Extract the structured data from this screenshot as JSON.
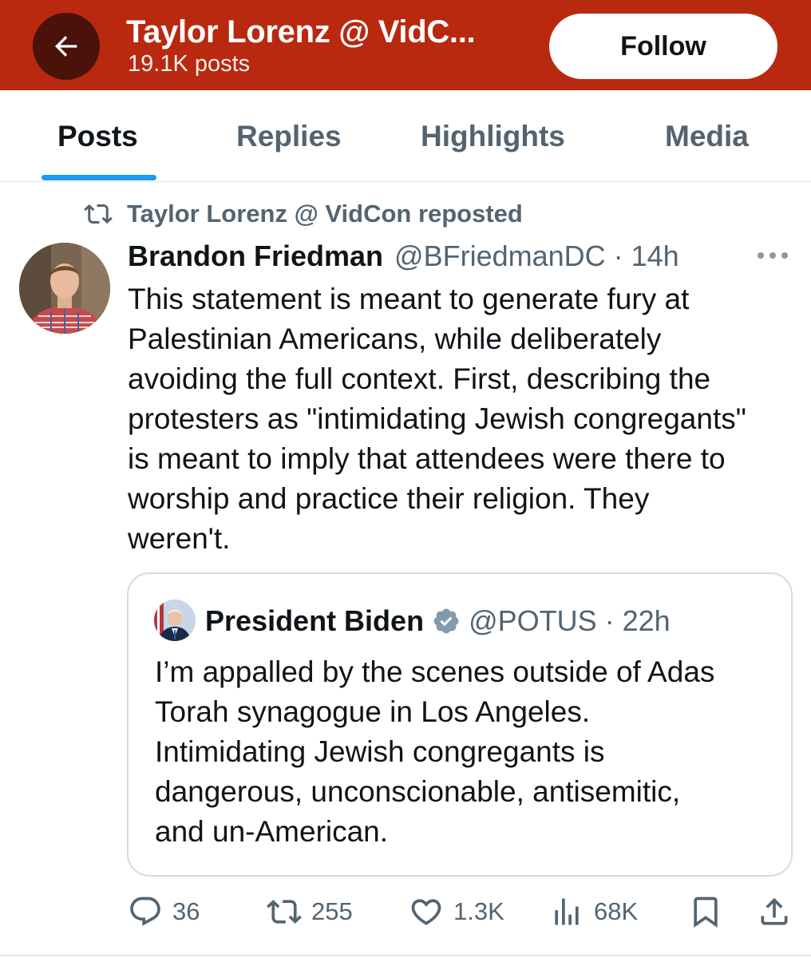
{
  "header": {
    "title": "Taylor Lorenz @ VidC...",
    "subtitle": "19.1K posts",
    "follow_label": "Follow",
    "back_icon": "arrow-left-icon",
    "background_color": "#b8290f"
  },
  "tabs": [
    {
      "label": "Posts",
      "active": true
    },
    {
      "label": "Replies",
      "active": false
    },
    {
      "label": "Highlights",
      "active": false
    },
    {
      "label": "Media",
      "active": false
    }
  ],
  "post": {
    "repost_label": "Taylor Lorenz @ VidCon reposted",
    "author_name": "Brandon Friedman",
    "author_handle_time": "@BFriedmanDC · 14h",
    "text_lines": [
      "This statement is meant to generate fury at",
      "Palestinian Americans, while deliberately",
      "avoiding the full context. First, describing the",
      "protesters as \"intimidating Jewish congregants\"",
      "is meant to imply that attendees were there to",
      "worship and practice their religion. They",
      "weren't."
    ],
    "quote": {
      "author_name": "President Biden",
      "author_handle_time": "@POTUS · 22h",
      "text_lines": [
        "I’m appalled by the scenes outside of Adas",
        "Torah synagogue in Los Angeles.",
        "Intimidating Jewish congregants is",
        "dangerous, unconscionable, antisemitic,",
        "and un-American."
      ]
    },
    "actions": {
      "replies": "36",
      "reposts": "255",
      "likes": "1.3K",
      "views": "68K"
    }
  },
  "colors": {
    "accent": "#1d9bf0",
    "secondary_text": "#536471",
    "primary_text": "#0f1419"
  }
}
